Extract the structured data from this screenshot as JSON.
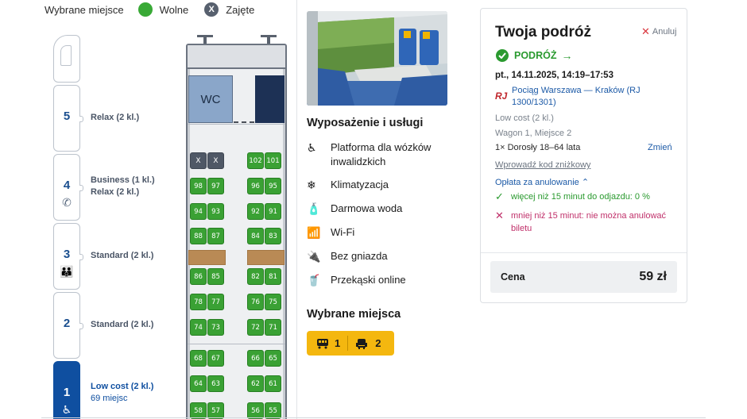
{
  "legend": {
    "selected_label": "Wybrane miejsce",
    "free_label": "Wolne",
    "taken_label": "Zajęte",
    "taken_mark": "X"
  },
  "wagons": [
    {
      "number": "5",
      "label": "Relax (2 kl.)",
      "icon": "none"
    },
    {
      "number": "4",
      "label_line1": "Business (1 kl.)",
      "label_line2": "Relax (2 kl.)",
      "icon": "no-phone-icon",
      "icon_glyph": "✆"
    },
    {
      "number": "3",
      "label": "Standard (2 kl.)",
      "icon": "family-icon",
      "icon_glyph": "👪"
    },
    {
      "number": "2",
      "label": "Standard (2 kl.)",
      "icon": "none"
    },
    {
      "number": "1",
      "label": "Low cost (2 kl.)",
      "sub": "69 miejsc",
      "icon": "wheelchair-icon",
      "icon_glyph": "♿",
      "selected": true
    }
  ],
  "coach": {
    "wc_label": "WC",
    "rows": [
      {
        "left": [
          "X",
          "X"
        ],
        "right": [
          "102",
          "101"
        ],
        "left_taken": true
      },
      {
        "left": [
          "98",
          "97"
        ],
        "right": [
          "96",
          "95"
        ]
      },
      {
        "left": [
          "94",
          "93"
        ],
        "right": [
          "92",
          "91"
        ]
      },
      {
        "left": [
          "88",
          "87"
        ],
        "right": [
          "84",
          "83"
        ]
      },
      {
        "left": [
          "86",
          "85"
        ],
        "right": [
          "82",
          "81"
        ]
      },
      {
        "left": [
          "78",
          "77"
        ],
        "right": [
          "76",
          "75"
        ]
      },
      {
        "left": [
          "74",
          "73"
        ],
        "right": [
          "72",
          "71"
        ]
      },
      {
        "left": [
          "68",
          "67"
        ],
        "right": [
          "66",
          "65"
        ]
      },
      {
        "left": [
          "64",
          "63"
        ],
        "right": [
          "62",
          "61"
        ]
      },
      {
        "left": [
          "58",
          "57"
        ],
        "right": [
          "56",
          "55"
        ]
      }
    ]
  },
  "amenities": {
    "title": "Wyposażenie i usługi",
    "items": [
      {
        "icon": "wheelchair-icon",
        "glyph": "♿",
        "line1": "Platforma dla wózków",
        "line2": "inwalidzkich"
      },
      {
        "icon": "snowflake-icon",
        "glyph": "❄",
        "line1": "Klimatyzacja"
      },
      {
        "icon": "water-bottle-icon",
        "glyph": "🧴",
        "line1": "Darmowa woda"
      },
      {
        "icon": "wifi-icon",
        "glyph": "📶",
        "line1": "Wi-Fi"
      },
      {
        "icon": "no-plug-icon",
        "glyph": "🔌",
        "line1": "Bez gniazda"
      },
      {
        "icon": "snack-icon",
        "glyph": "🥤",
        "line1": "Przekąski online"
      }
    ]
  },
  "selected_seats": {
    "title": "Wybrane miejsca",
    "wagon_value": "1",
    "seat_value": "2"
  },
  "trip": {
    "title": "Twoja podróż",
    "cancel": "Anuluj",
    "direction": "PODRÓŻ",
    "date": "pt., 14.11.2025, 14:19–17:53",
    "carrier_logo": "RJ",
    "train": "Pociąg Warszawa — Kraków (RJ 1300/1301)",
    "fare": "Low cost (2 kl.)",
    "seat": "Wagon 1, Miejsce 2",
    "passenger": "1× Dorosły 18–64 lata",
    "change": "Zmień",
    "discount": "Wprowadź kod zniżkowy",
    "cancel_fee": "Opłata za anulowanie",
    "rule_ok": "więcej niż 15 minut do odjazdu: 0 %",
    "rule_bad": "mniej niż 15 minut: nie można anulować biletu",
    "price_label": "Cena",
    "price_value": "59 zł"
  },
  "colors": {
    "free_seat": "#3aa134",
    "taken_seat": "#4f5866",
    "selected_wagon": "#0f4fa0",
    "accent_yellow": "#f4b70f",
    "ok_green": "#2a9a2f",
    "error_red": "#c0306a",
    "link_blue": "#1c5aa7"
  }
}
